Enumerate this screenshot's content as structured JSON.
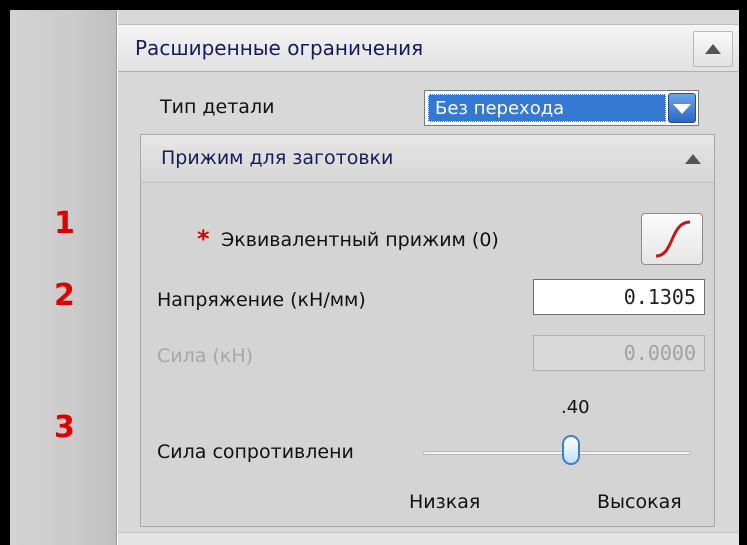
{
  "panel": {
    "title": "Расширенные ограничения"
  },
  "part_type": {
    "label": "Тип детали",
    "selected": "Без перехода"
  },
  "group": {
    "title": "Прижим для заготовки",
    "required_marker": "*",
    "equivalent_label": "Эквивалентный прижим (0)",
    "stress_label": "Напряжение (кН/мм)",
    "stress_value": "0.1305",
    "force_label": "Сила (кН)",
    "force_value": "0.0000",
    "resistance_label": "Сила сопротивлени",
    "resistance_value_text": ".40",
    "resistance_fraction": 0.4,
    "low_label": "Низкая",
    "high_label": "Высокая"
  },
  "annotations": [
    "1",
    "2",
    "3"
  ],
  "colors": {
    "annotation": "#e00000",
    "selection": "#3478d2",
    "header_text": "#1a1a5a",
    "disabled_text": "#a7a7a7"
  },
  "icons": {
    "collapse": "chevron-up-icon",
    "dropdown": "chevron-down-icon",
    "curve": "s-curve-icon"
  }
}
